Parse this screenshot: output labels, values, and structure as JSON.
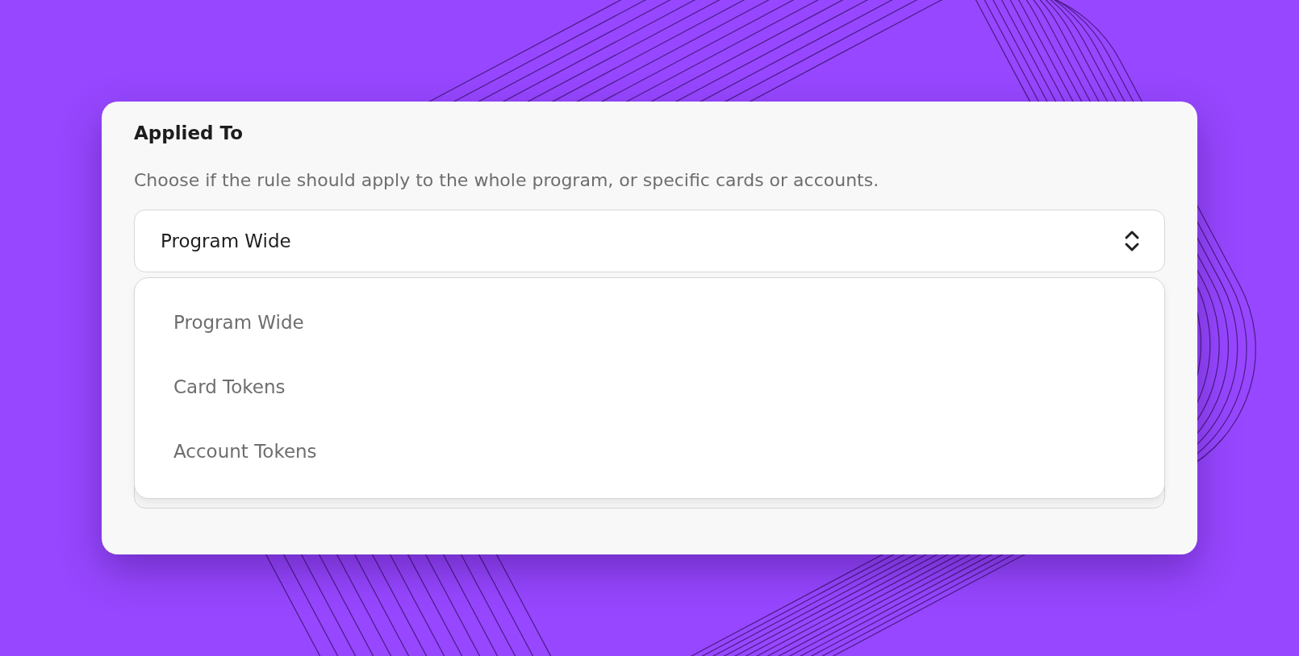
{
  "section": {
    "title": "Applied To",
    "description": "Choose if the rule should apply to the whole program, or specific cards or accounts."
  },
  "select": {
    "value": "Program Wide",
    "open": true
  },
  "dropdown": {
    "options": [
      {
        "label": "Program Wide"
      },
      {
        "label": "Card Tokens"
      },
      {
        "label": "Account Tokens"
      }
    ]
  }
}
